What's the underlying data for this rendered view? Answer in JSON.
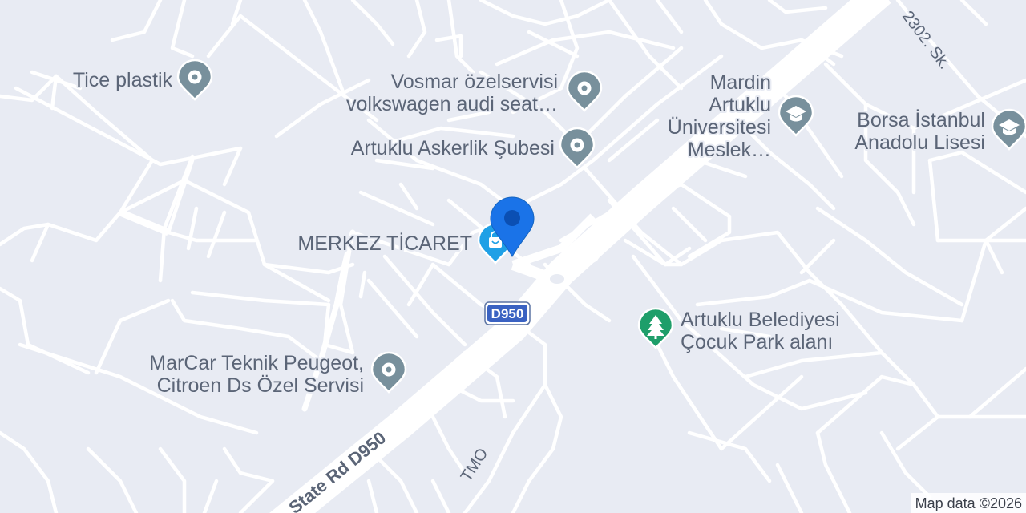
{
  "map": {
    "attribution": "Map data ©2026",
    "highway": {
      "label": "State Rd D950",
      "shield": "D950"
    },
    "streets": [
      {
        "label": "2302. Sk."
      },
      {
        "label": "TMO"
      }
    ],
    "pois": [
      {
        "lines": [
          "Tice plastik"
        ],
        "icon": "generic-poi-icon",
        "color": "#78909c"
      },
      {
        "lines": [
          "Vosmar özelservisi",
          "volkswagen audi seat…"
        ],
        "icon": "generic-poi-icon",
        "color": "#78909c"
      },
      {
        "lines": [
          "Artuklu Askerlik Şubesi"
        ],
        "icon": "generic-poi-icon",
        "color": "#78909c"
      },
      {
        "lines": [
          "Mardin",
          "Artuklu",
          "Üniversitesi",
          "Meslek…"
        ],
        "icon": "school-icon",
        "color": "#78909c"
      },
      {
        "lines": [
          "Borsa İstanbul",
          "Anadolu Lisesi"
        ],
        "icon": "school-icon",
        "color": "#78909c"
      },
      {
        "lines": [
          "MERKEZ TİCARET"
        ],
        "icon": "shopping-bag-icon",
        "color": "#1fa0e6"
      },
      {
        "lines": [
          "MarCar Teknik Peugeot,",
          "Citroen Ds Özel Servisi"
        ],
        "icon": "generic-poi-icon",
        "color": "#78909c"
      },
      {
        "lines": [
          "Artuklu Belediyesi",
          "Çocuk Park alanı"
        ],
        "icon": "tree-icon",
        "color": "#1e9e6a"
      }
    ],
    "marker": {
      "color": "#1a73e8",
      "dot_color": "#0b4fb3"
    }
  }
}
